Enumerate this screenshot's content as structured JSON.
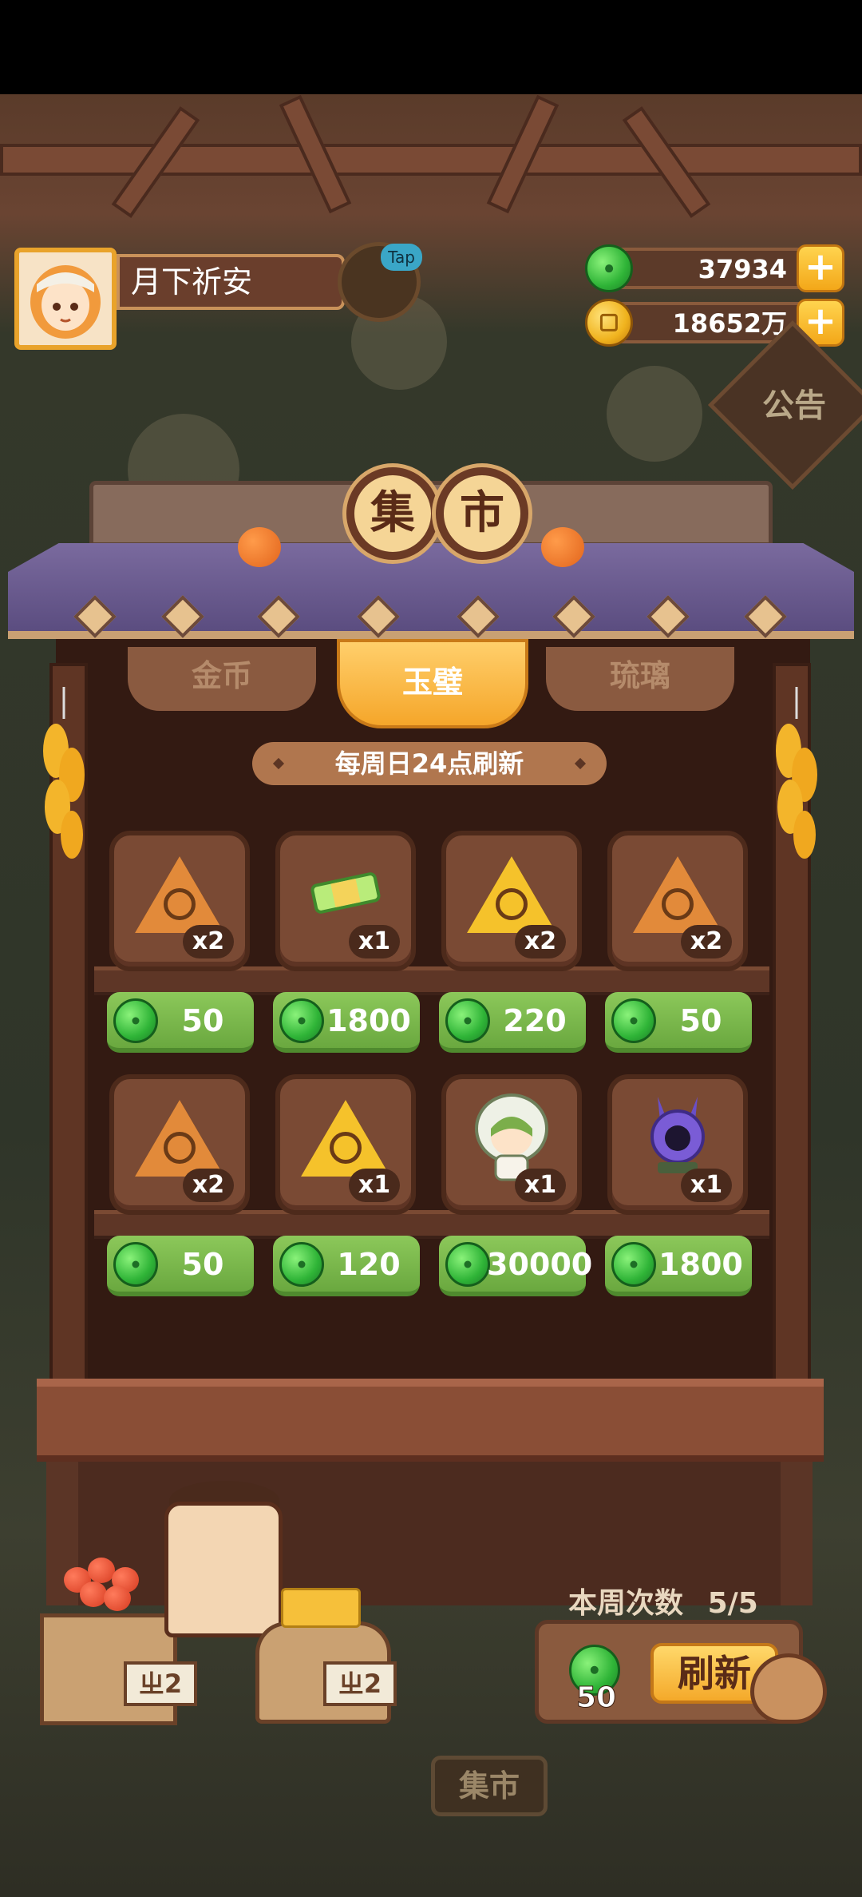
{
  "profile": {
    "name": "月下祈安"
  },
  "tap_label": "Tap",
  "currencies": {
    "jade": {
      "icon": "jade-icon",
      "value": "37934"
    },
    "coin": {
      "icon": "coin-icon",
      "value": "18652万"
    },
    "plus_symbol": "+"
  },
  "notice": {
    "label": "公告"
  },
  "shop": {
    "title_chars": [
      "集",
      "市"
    ],
    "tabs": [
      {
        "label": "金币",
        "active": false
      },
      {
        "label": "玉璧",
        "active": true
      },
      {
        "label": "琉璃",
        "active": false
      }
    ],
    "refresh_note": "每周日24点刷新",
    "items": [
      {
        "icon": "orange-talisman-wheel-icon",
        "qty": "x2",
        "price": "50"
      },
      {
        "icon": "jade-scroll-icon",
        "qty": "x1",
        "price": "1800"
      },
      {
        "icon": "gold-talisman-icon",
        "qty": "x2",
        "price": "220"
      },
      {
        "icon": "orange-talisman-flower-icon",
        "qty": "x2",
        "price": "50"
      },
      {
        "icon": "orange-talisman-sun-icon",
        "qty": "x2",
        "price": "50"
      },
      {
        "icon": "gold-talisman-spiral-icon",
        "qty": "x1",
        "price": "120"
      },
      {
        "icon": "green-hood-character-icon",
        "qty": "x1",
        "price": "30000"
      },
      {
        "icon": "purple-rabbit-shrine-icon",
        "qty": "x1",
        "price": "1800"
      }
    ]
  },
  "weekly": {
    "label": "本周次数",
    "count": "5/5",
    "refresh_cost": "50",
    "refresh_button": "刷新"
  },
  "stall_signs": [
    "ㄓ2",
    "ㄓ2"
  ],
  "bottom_tab": "集市",
  "colors": {
    "accent_gold": "#f5a62a",
    "price_green": "#6aa83f",
    "wood_dark": "#4d2a1b"
  }
}
